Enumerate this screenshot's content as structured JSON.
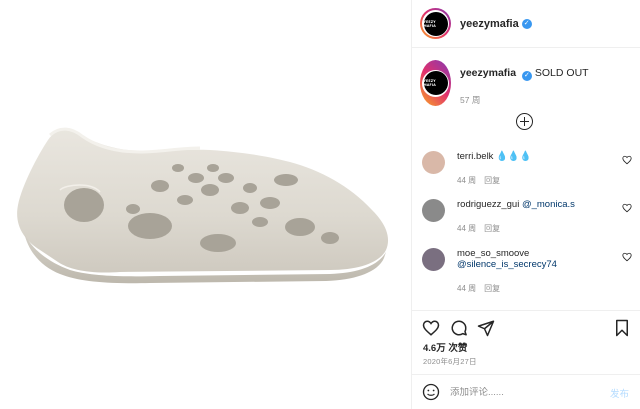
{
  "header": {
    "username": "yeezymafia",
    "avatar_logo": "YEEZY MAFIA",
    "verified_icon": "verified-badge-icon"
  },
  "caption": {
    "username": "yeezymafia",
    "text": "SOLD OUT",
    "time": "57 周"
  },
  "comments": [
    {
      "user": "terri.belk",
      "text": "💧💧💧",
      "time": "44 周",
      "reply": "回复",
      "avatar_color": "#d9b8a8"
    },
    {
      "user": "rodriguezz_gui",
      "text": "@_monica.s",
      "time": "44 周",
      "reply": "回复",
      "avatar_color": "#8a8a8a"
    },
    {
      "user": "moe_so_smoove",
      "text": "@silence_is_secrecy74",
      "time": "44 周",
      "reply": "回复",
      "avatar_color": "#7a6f80"
    }
  ],
  "likes": "4.6万 次赞",
  "date": "2020年6月27日",
  "add_comment": {
    "placeholder": "添加评论......",
    "post_label": "发布"
  },
  "colors": {
    "verified": "#3897f0",
    "mention": "#00376b",
    "post_disabled": "#b3dbff"
  }
}
